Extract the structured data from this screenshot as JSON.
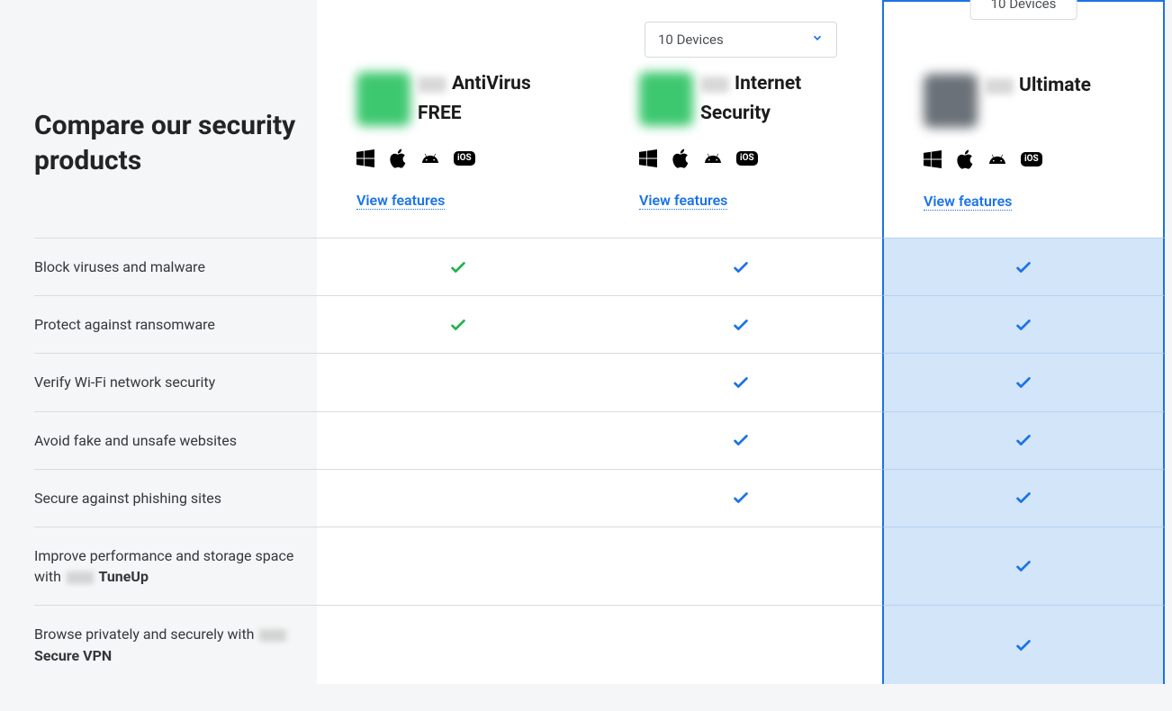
{
  "title": "Compare our security products",
  "devices_dropdown_label": "10 Devices",
  "devices_badge_label": "10 Devices",
  "products": {
    "free": {
      "name_parts": [
        "AntiVirus",
        "FREE"
      ],
      "view_features": "View features"
    },
    "internet": {
      "name_parts": [
        "Internet",
        "Security"
      ],
      "view_features": "View features"
    },
    "ultimate": {
      "name": "Ultimate",
      "view_features": "View features"
    }
  },
  "features": [
    {
      "label": "Block viruses and malware",
      "free": true,
      "internet": true,
      "ultimate": true
    },
    {
      "label": "Protect against ransomware",
      "free": true,
      "internet": true,
      "ultimate": true
    },
    {
      "label": "Verify Wi-Fi network security",
      "free": false,
      "internet": true,
      "ultimate": true
    },
    {
      "label": "Avoid fake and unsafe websites",
      "free": false,
      "internet": true,
      "ultimate": true
    },
    {
      "label": "Secure against phishing sites",
      "free": false,
      "internet": true,
      "ultimate": true
    },
    {
      "label_pre": "Improve performance and storage space with ",
      "label_bold": "TuneUp",
      "free": false,
      "internet": false,
      "ultimate": true
    },
    {
      "label_pre": "Browse privately and securely with ",
      "label_bold": "Secure VPN",
      "free": false,
      "internet": false,
      "ultimate": true
    }
  ],
  "icons": {
    "windows": "windows-icon",
    "apple": "apple-icon",
    "android": "android-icon",
    "ios": "iOS"
  }
}
